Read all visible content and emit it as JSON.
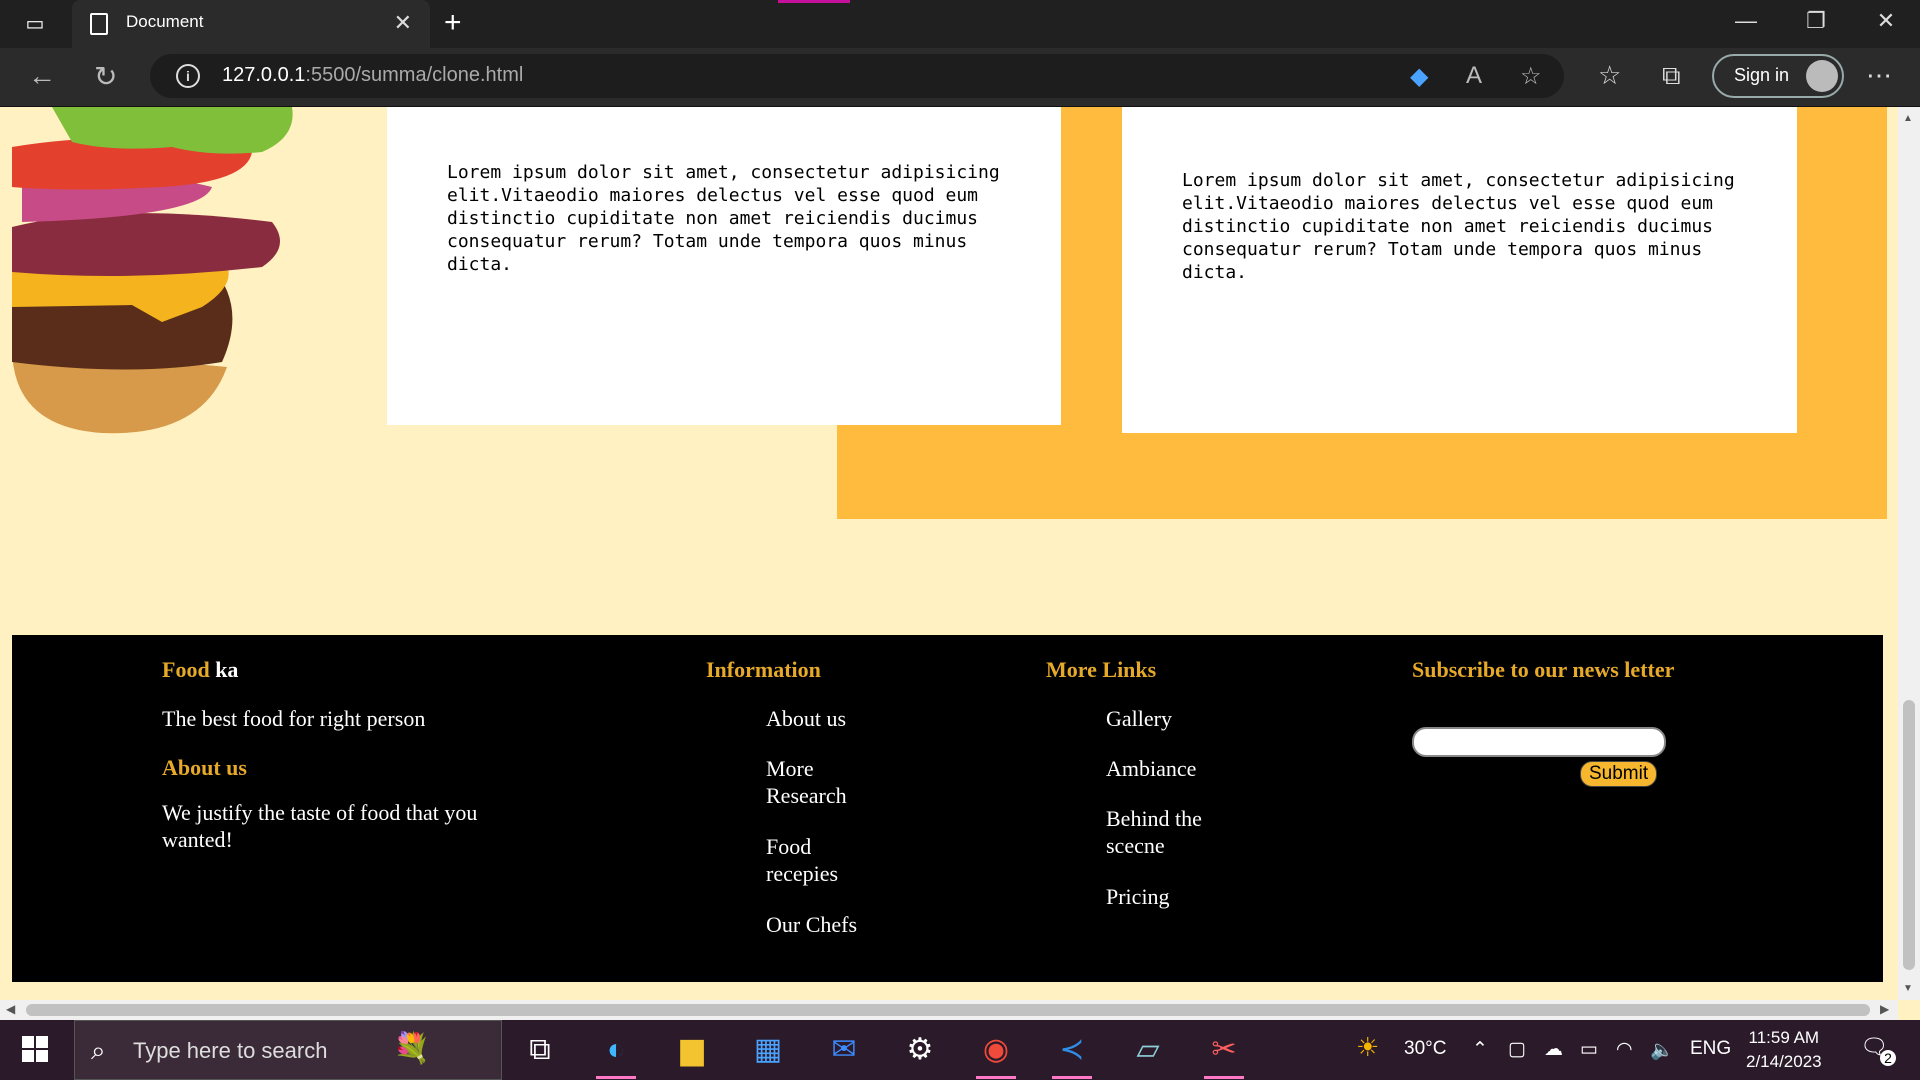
{
  "browser": {
    "tab_title": "Document",
    "url_host": "127.0.0.1",
    "url_rest": ":5500/summa/clone.html",
    "signin_label": "Sign in"
  },
  "page": {
    "card1_text": "Lorem ipsum dolor sit amet, consectetur adipisicing elit.Vitaeodio maiores delectus vel esse quod eum distinctio cupiditate non amet reiciendis ducimus consequatur rerum? Totam unde tempora quos minus dicta.",
    "card2_text": "Lorem ipsum dolor sit amet, consectetur adipisicing elit.Vitaeodio maiores delectus vel esse quod eum distinctio cupiditate non amet reiciendis ducimus consequatur rerum? Totam unde tempora quos minus dicta."
  },
  "footer": {
    "brand_a": "Food",
    "brand_b": "ka",
    "tagline": "The best food for right person",
    "about_heading": "About us",
    "about_text": "We justify the taste of food that you wanted!",
    "info_heading": "Information",
    "info_links": [
      "About us",
      "More Research",
      "Food recepies",
      "Our Chefs"
    ],
    "more_heading": "More Links",
    "more_links": [
      "Gallery",
      "Ambiance",
      "Behind the scecne",
      "Pricing"
    ],
    "subscribe_heading": "Subscribe to our news letter",
    "submit_label": "Submit"
  },
  "taskbar": {
    "search_placeholder": "Type here to search",
    "weather": "30°C",
    "language": "ENG",
    "time": "11:59 AM",
    "date": "2/14/2023",
    "notification_count": "2"
  },
  "colors": {
    "page_bg": "#fff1c1",
    "accent_yellow": "#febb3d",
    "footer_heading": "#e6a92a"
  }
}
